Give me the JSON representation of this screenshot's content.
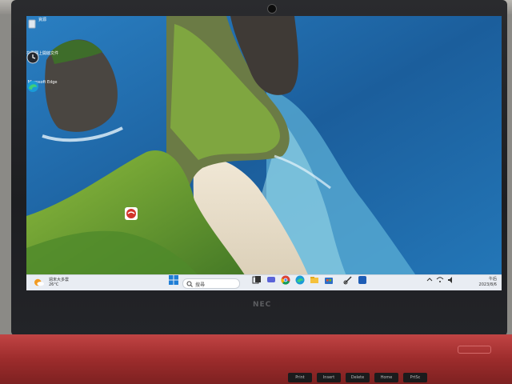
{
  "desktop": {
    "icons": [
      {
        "name": "recycle-bin-icon",
        "label": "資源"
      },
      {
        "name": "clock-app-icon",
        "label": "在電腦上開啟文件"
      },
      {
        "name": "edge-icon",
        "label": "Microsoft Edge"
      },
      {
        "name": "security-app-icon",
        "label": ""
      }
    ]
  },
  "taskbar": {
    "widget_line1": "週末大多雲",
    "widget_line2": "26°C",
    "search_placeholder": "搜尋",
    "tray_time": "午后",
    "tray_date": "2023/8/6"
  },
  "bezel_brand": "NEC",
  "keyboard": {
    "keys": [
      "Print",
      "Insert",
      "Delete",
      "Home",
      "PrtSc"
    ]
  },
  "colors": {
    "ocean": "#1f6fb3",
    "cliff": "#5f8f2f",
    "taskbar": "#e9edf3",
    "chassis_red": "#b33a3a"
  }
}
